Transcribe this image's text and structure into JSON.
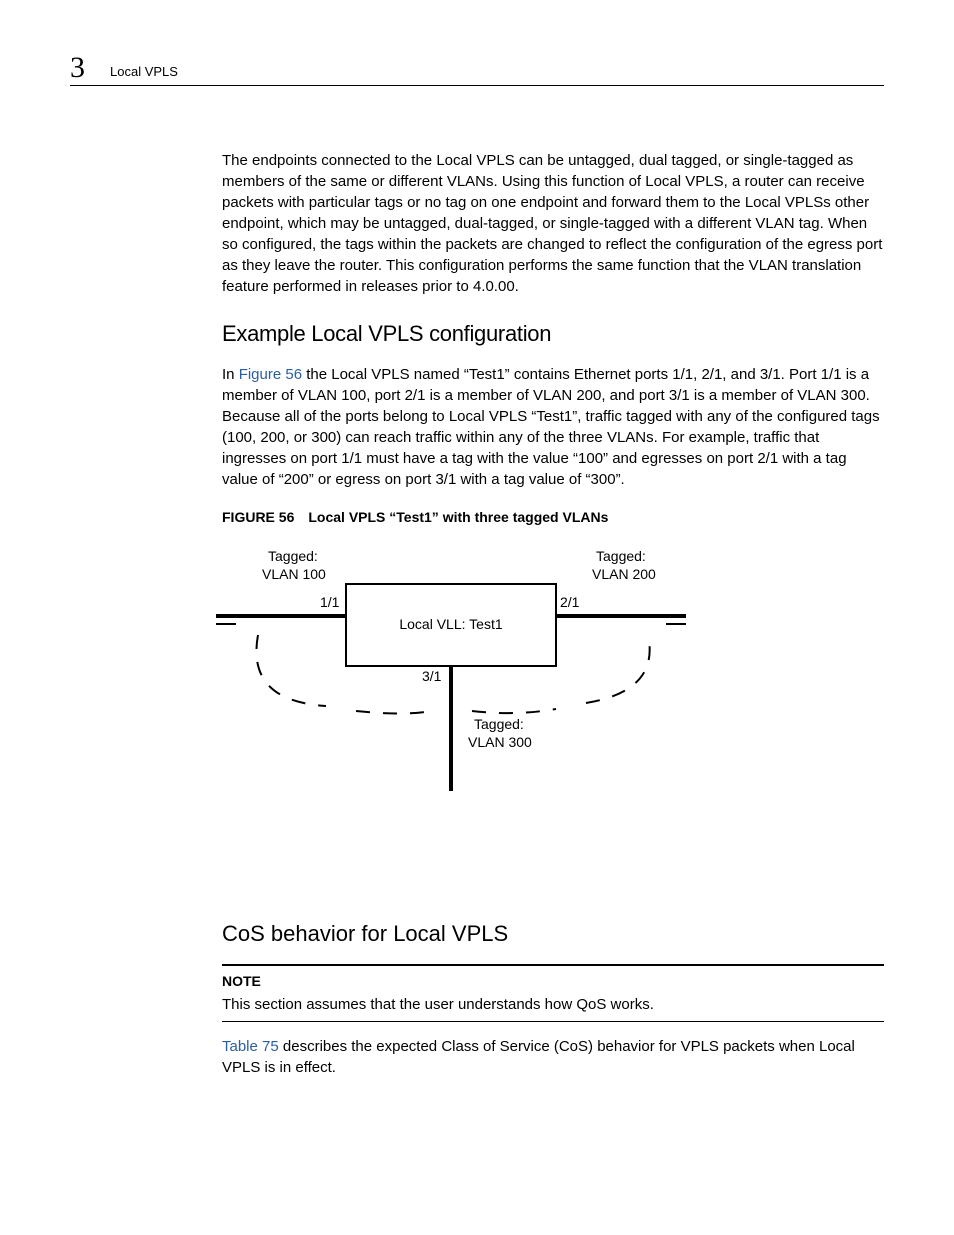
{
  "chapterNumber": "3",
  "chapterTitle": "Local VPLS",
  "para1": "The endpoints connected to the Local VPLS can be untagged, dual tagged, or single-tagged as members of the same or different VLANs. Using this function of Local VPLS, a router can receive packets with particular tags or no tag on one endpoint and forward them to the Local VPLSs other endpoint, which may be untagged, dual-tagged, or single-tagged with a different VLAN tag. When so configured, the tags within the packets are changed to reflect the configuration of the egress port as they leave the router. This configuration performs the same function that the VLAN translation feature performed in releases prior to 4.0.00.",
  "heading1": "Example Local VPLS configuration",
  "para2_pre": "In ",
  "figureRef1": "Figure 56",
  "para2_post": " the Local VPLS named “Test1” contains Ethernet ports 1/1, 2/1, and 3/1. Port 1/1 is a member of VLAN 100, port 2/1 is a member of VLAN 200, and port 3/1 is a member of VLAN 300. Because all of the ports belong to Local VPLS “Test1”, traffic tagged with any of the configured tags (100, 200, or 300) can reach traffic within any of the three VLANs. For example, traffic that ingresses on port 1/1 must have a tag with the value “100” and egresses on port 2/1 with a tag value of “200” or egress on port 3/1 with a tag value of “300”.",
  "figure": {
    "label": "FIGURE 56",
    "caption": "Local VPLS “Test1” with three tagged VLANs",
    "boxText": "Local VLL: Test1",
    "port1": "1/1",
    "port2": "2/1",
    "port3": "3/1",
    "tag1a": "Tagged:",
    "tag1b": "VLAN 100",
    "tag2a": "Tagged:",
    "tag2b": "VLAN 200",
    "tag3a": "Tagged:",
    "tag3b": "VLAN 300"
  },
  "heading2": "CoS behavior for Local VPLS",
  "noteLabel": "NOTE",
  "noteText": "This section assumes that the user understands how QoS works.",
  "tableRef": "Table 75",
  "para3_post": " describes the expected Class of Service (CoS) behavior for VPLS packets when Local VPLS is in effect."
}
